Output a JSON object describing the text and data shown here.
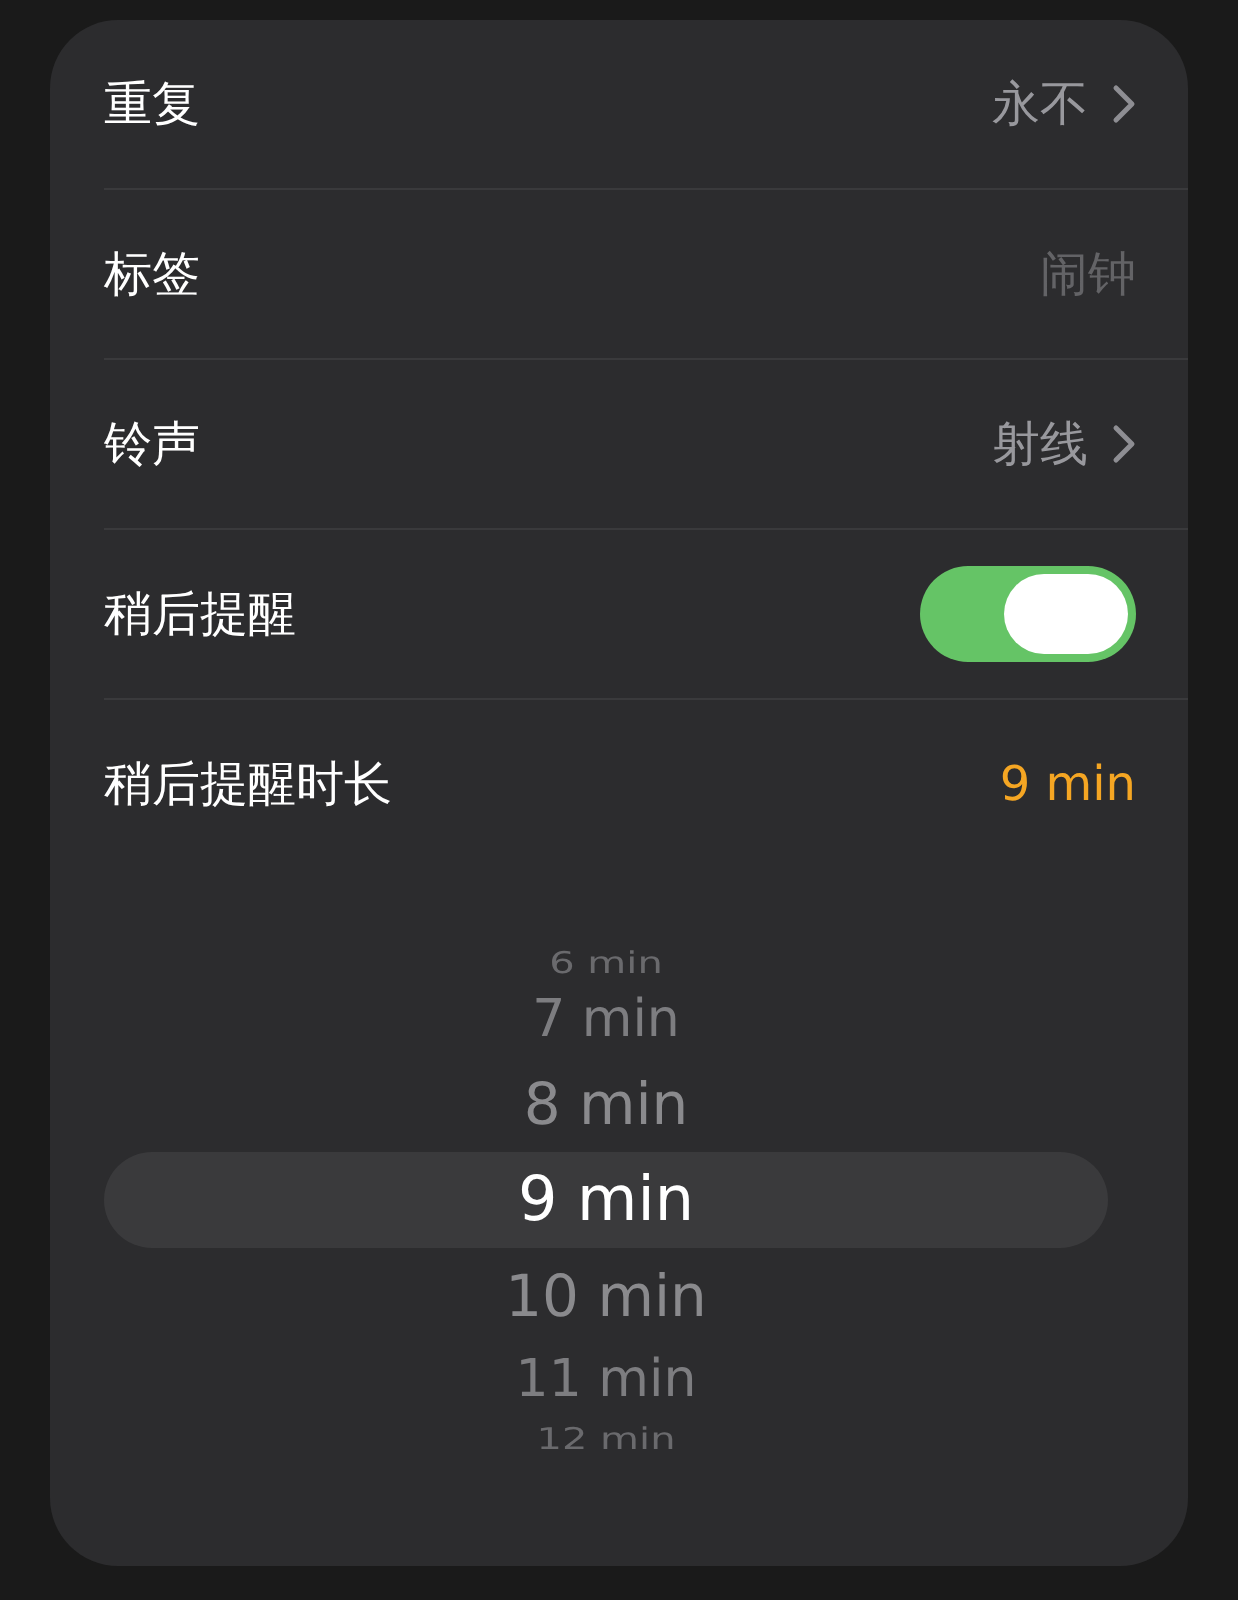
{
  "rows": [
    {
      "kind": "link",
      "label": "重复",
      "value": "永不"
    },
    {
      "kind": "text",
      "label": "标签",
      "placeholder": "闹钟"
    },
    {
      "kind": "link",
      "label": "铃声",
      "value": "射线"
    },
    {
      "kind": "toggle",
      "label": "稍后提醒",
      "on": true
    },
    {
      "kind": "accent",
      "label": "稍后提醒时长",
      "value": "9 min"
    }
  ],
  "picker": [
    {
      "label": "6 min",
      "selected": false
    },
    {
      "label": "7 min",
      "selected": false
    },
    {
      "label": "8 min",
      "selected": false
    },
    {
      "label": "9 min",
      "selected": true
    },
    {
      "label": "10 min",
      "selected": false
    },
    {
      "label": "11 min",
      "selected": false
    },
    {
      "label": "12 min",
      "selected": false
    }
  ]
}
